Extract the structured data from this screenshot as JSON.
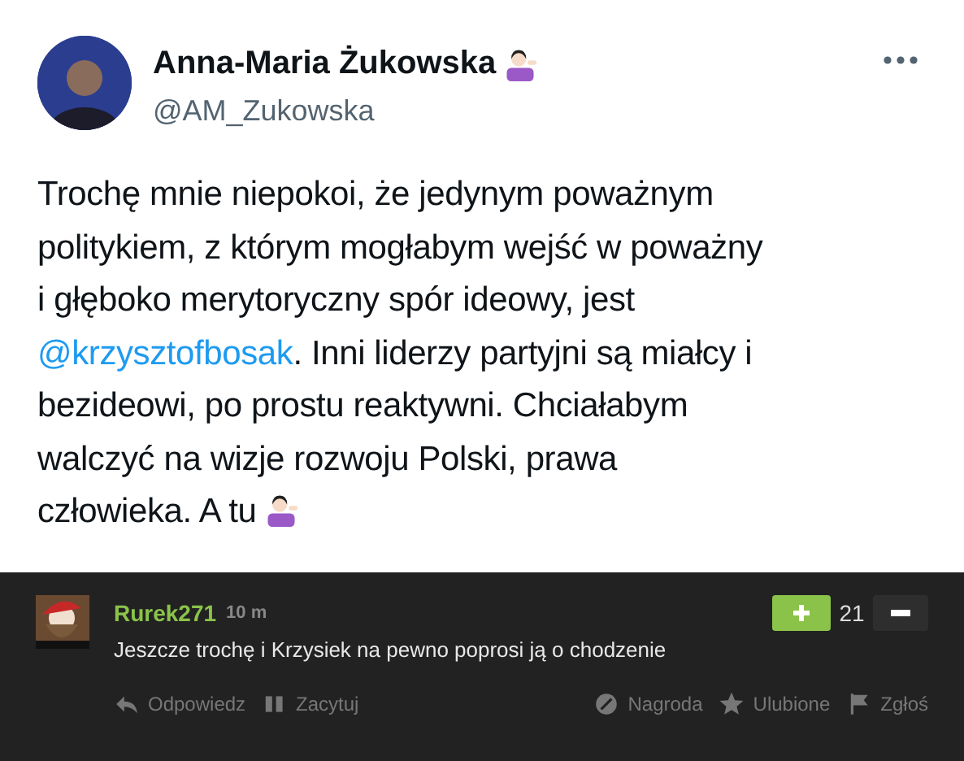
{
  "tweet": {
    "author": "Anna-Maria Żukowska",
    "handle": "@AM_Zukowska",
    "lines": [
      [
        {
          "kind": "text",
          "text": "Trochę mnie niepokoi, że jedynym poważnym"
        }
      ],
      [
        {
          "kind": "text",
          "text": "politykiem, z którym mogłabym wejść w poważny"
        }
      ],
      [
        {
          "kind": "text",
          "text": "i głęboko merytoryczny spór ideowy, jest"
        }
      ],
      [
        {
          "kind": "mention",
          "text": "@krzysztofbosak"
        },
        {
          "kind": "text",
          "text": ". Inni liderzy partyjni są miałcy i"
        }
      ],
      [
        {
          "kind": "text",
          "text": "bezideowi, po prostu reaktywni. Chciałabym"
        }
      ],
      [
        {
          "kind": "text",
          "text": "walczyć na wizje rozwoju Polski, prawa"
        }
      ],
      [
        {
          "kind": "text",
          "text": "człowieka. A tu"
        },
        {
          "kind": "emoji"
        }
      ]
    ]
  },
  "comment": {
    "user": "Rurek271",
    "time": "10 m",
    "text": "Jeszcze trochę i Krzysiek na pewno poprosi ją o chodzenie",
    "score": "21",
    "actions_left": [
      "Odpowiedz",
      "Zacytuj"
    ],
    "actions_right": [
      "Nagroda",
      "Ulubione",
      "Zgłoś"
    ]
  }
}
